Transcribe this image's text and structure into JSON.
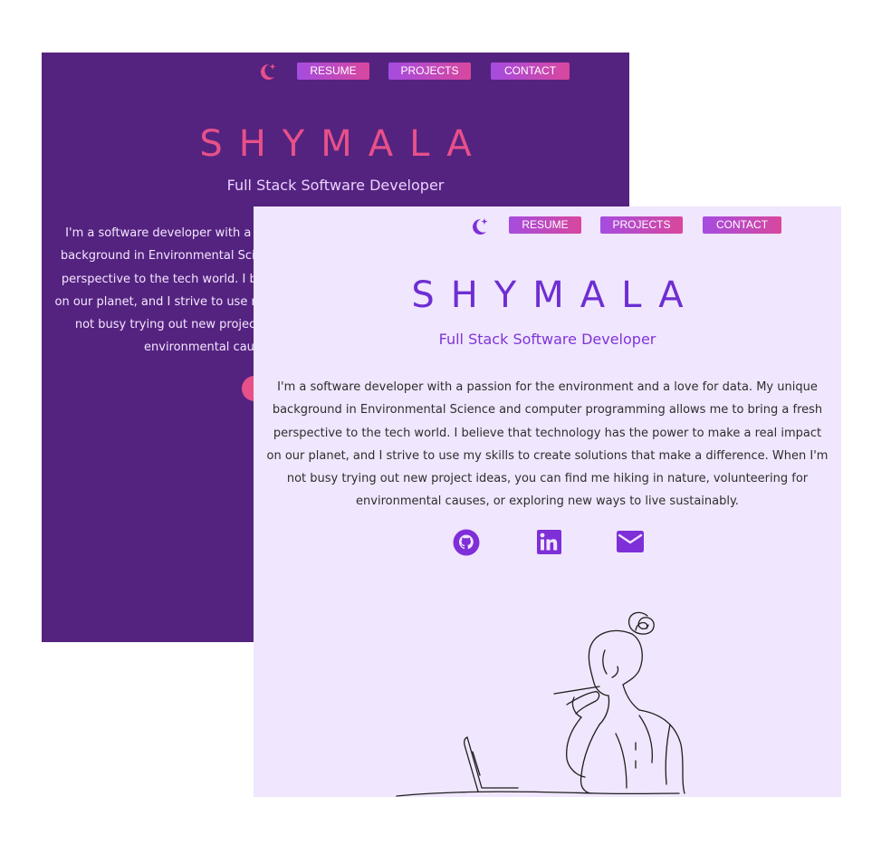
{
  "nav": {
    "resume": "RESUME",
    "projects": "PROJECTS",
    "contact": "CONTACT"
  },
  "hero": {
    "name": "SHYMALA",
    "subtitle": "Full Stack Software Developer",
    "bio": "I'm a software developer with a passion for the environment and a love for data. My unique background in Environmental Science and computer programming allows me to bring a fresh perspective to the tech world. I believe that technology has the power to make a real impact on our planet, and I strive to use my skills to create solutions that make a difference. When I'm not busy trying out new project ideas, you can find me hiking in nature, volunteering for environmental causes, or exploring new ways to live sustainably."
  },
  "icons": {
    "theme_toggle": "moon-star-icon",
    "github": "github-icon",
    "linkedin": "linkedin-icon",
    "email": "email-icon"
  },
  "colors": {
    "dark_background": "#54237f",
    "dark_name": "#e8508a",
    "light_background": "#f0e6fd",
    "light_name": "#6e2ed2",
    "accent": "#7e2fd8",
    "button_gradient_start": "#a54ce0",
    "button_gradient_end": "#d8479d"
  }
}
